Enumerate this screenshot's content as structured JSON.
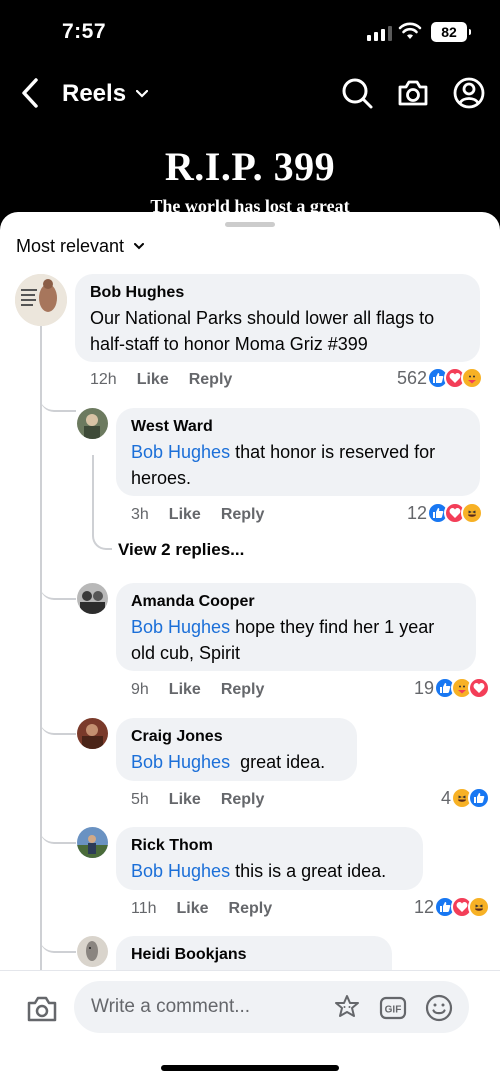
{
  "status_bar": {
    "time": "7:57",
    "battery": "82"
  },
  "header": {
    "title": "Reels"
  },
  "video": {
    "headline": "R.I.P. 399",
    "subline": "The world has lost a great"
  },
  "sort": {
    "label": "Most relevant"
  },
  "comments": [
    {
      "name": "Bob Hughes",
      "text": "Our National Parks should lower all flags to half-staff to honor Moma Griz #399",
      "time": "12h",
      "like": "Like",
      "reply": "Reply",
      "count": "562"
    }
  ],
  "replies": [
    {
      "name": "West Ward",
      "mention": "Bob Hughes",
      "text": " that honor is reserved for heroes.",
      "time": "3h",
      "like": "Like",
      "reply": "Reply",
      "count": "12"
    },
    {
      "name": "Amanda Cooper",
      "mention": "Bob Hughes",
      "text": " hope they find her 1 year old cub, Spirit",
      "time": "9h",
      "like": "Like",
      "reply": "Reply",
      "count": "19"
    },
    {
      "name": "Craig Jones",
      "mention": "Bob Hughes",
      "text": "  great idea.",
      "time": "5h",
      "like": "Like",
      "reply": "Reply",
      "count": "4"
    },
    {
      "name": "Rick Thom",
      "mention": "Bob Hughes",
      "text": " this is a great idea.",
      "time": "11h",
      "like": "Like",
      "reply": "Reply",
      "count": "12"
    },
    {
      "name": "Heidi Bookjans"
    }
  ],
  "view_replies": "View 2 replies...",
  "composer": {
    "placeholder": "Write a comment..."
  },
  "colors": {
    "like_blue": "#1877f2",
    "love_red": "#f33e58",
    "haha_yellow": "#f7b125",
    "mention_blue": "#1b6fd8"
  }
}
